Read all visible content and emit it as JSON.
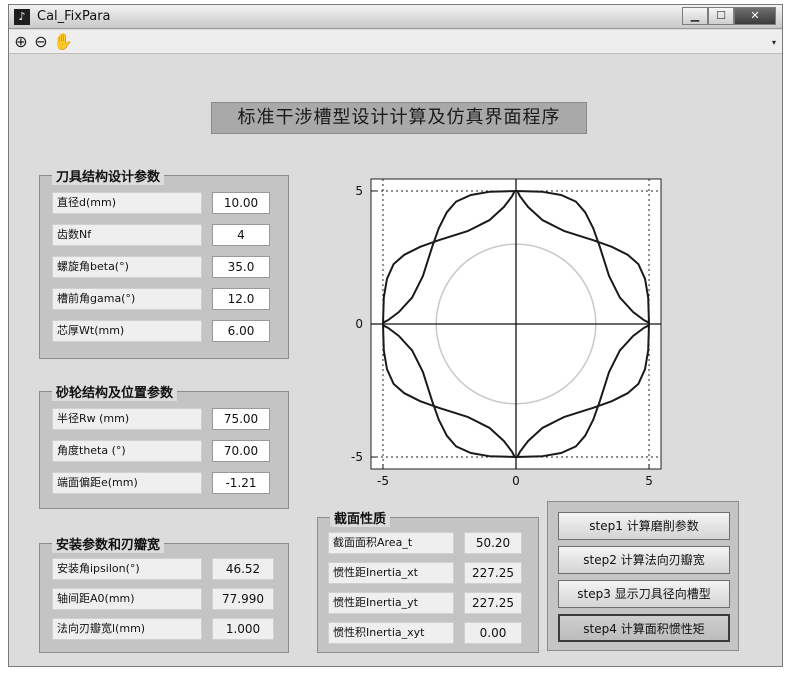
{
  "window": {
    "title": "Cal_FixPara",
    "minimize": "▁",
    "maximize": "☐",
    "close": "✕"
  },
  "toolbar": {
    "zoom_in": "⊕",
    "zoom_out": "⊖",
    "pan": "✋",
    "arrow": "▾"
  },
  "main_title": "标准干涉槽型设计计算及仿真界面程序",
  "tool_params": {
    "title": "刀具结构设计参数",
    "rows": [
      {
        "label": "直径d(mm)",
        "value": "10.00"
      },
      {
        "label": "齿数Nf",
        "value": "4"
      },
      {
        "label": "螺旋角beta(°)",
        "value": "35.0"
      },
      {
        "label": "槽前角gama(°)",
        "value": "12.0"
      },
      {
        "label": "芯厚Wt(mm)",
        "value": "6.00"
      }
    ]
  },
  "wheel_params": {
    "title": "砂轮结构及位置参数",
    "rows": [
      {
        "label": "半径Rw (mm)",
        "value": "75.00"
      },
      {
        "label": "角度theta (°)",
        "value": "70.00"
      },
      {
        "label": "端面偏距e(mm)",
        "value": "-1.21"
      }
    ]
  },
  "install_params": {
    "title": "安装参数和刃瓣宽",
    "rows": [
      {
        "label": "安装角ipsilon(°)",
        "value": "46.52"
      },
      {
        "label": "轴间距A0(mm)",
        "value": "77.990"
      },
      {
        "label": "法向刃瓣宽l(mm)",
        "value": "1.000"
      }
    ]
  },
  "section_props": {
    "title": "截面性质",
    "rows": [
      {
        "label": "截面面积Area_t",
        "value": "50.20"
      },
      {
        "label": "惯性距Inertia_xt",
        "value": "227.25"
      },
      {
        "label": "惯性距Inertia_yt",
        "value": "227.25"
      },
      {
        "label": "惯性积Inertia_xyt",
        "value": "0.00"
      }
    ]
  },
  "steps": [
    {
      "label": "step1 计算磨削参数"
    },
    {
      "label": "step2 计算法向刃瓣宽"
    },
    {
      "label": "step3 显示刀具径向槽型"
    },
    {
      "label": "step4 计算面积惯性矩"
    }
  ],
  "chart_data": {
    "type": "line",
    "title": "",
    "xlabel": "",
    "ylabel": "",
    "xlim": [
      -5,
      5
    ],
    "ylim": [
      -5,
      5
    ],
    "x_ticks": [
      "-5",
      "0",
      "5"
    ],
    "y_ticks": [
      "5",
      "0",
      "-5"
    ],
    "grid": false,
    "circle": {
      "radius": 3.0,
      "color": "#c8c8c8"
    },
    "bounding_lines": {
      "values": [
        -5,
        5
      ],
      "style": "dotted"
    },
    "series": [
      {
        "values": [
          [
            5.0,
            0.0
          ],
          [
            5.0,
            -0.05
          ],
          [
            4.8,
            -0.15
          ],
          [
            4.4,
            -0.45
          ],
          [
            3.9,
            -1.0
          ],
          [
            3.5,
            -1.8
          ],
          [
            3.15,
            -2.9
          ],
          [
            2.9,
            -3.6
          ],
          [
            2.6,
            -4.2
          ],
          [
            2.25,
            -4.6
          ],
          [
            1.7,
            -4.85
          ],
          [
            1.0,
            -4.97
          ],
          [
            0.0,
            -5.0
          ],
          [
            0.05,
            -5.0
          ],
          [
            0.15,
            -4.8
          ],
          [
            0.45,
            -4.4
          ],
          [
            1.0,
            -3.9
          ],
          [
            1.8,
            -3.5
          ],
          [
            2.9,
            -3.15
          ],
          [
            3.6,
            -2.9
          ],
          [
            4.2,
            -2.6
          ],
          [
            4.6,
            -2.25
          ],
          [
            4.85,
            -1.7
          ],
          [
            4.97,
            -1.0
          ],
          [
            5.0,
            0.0
          ]
        ],
        "color": "#1a1a1a"
      }
    ]
  }
}
